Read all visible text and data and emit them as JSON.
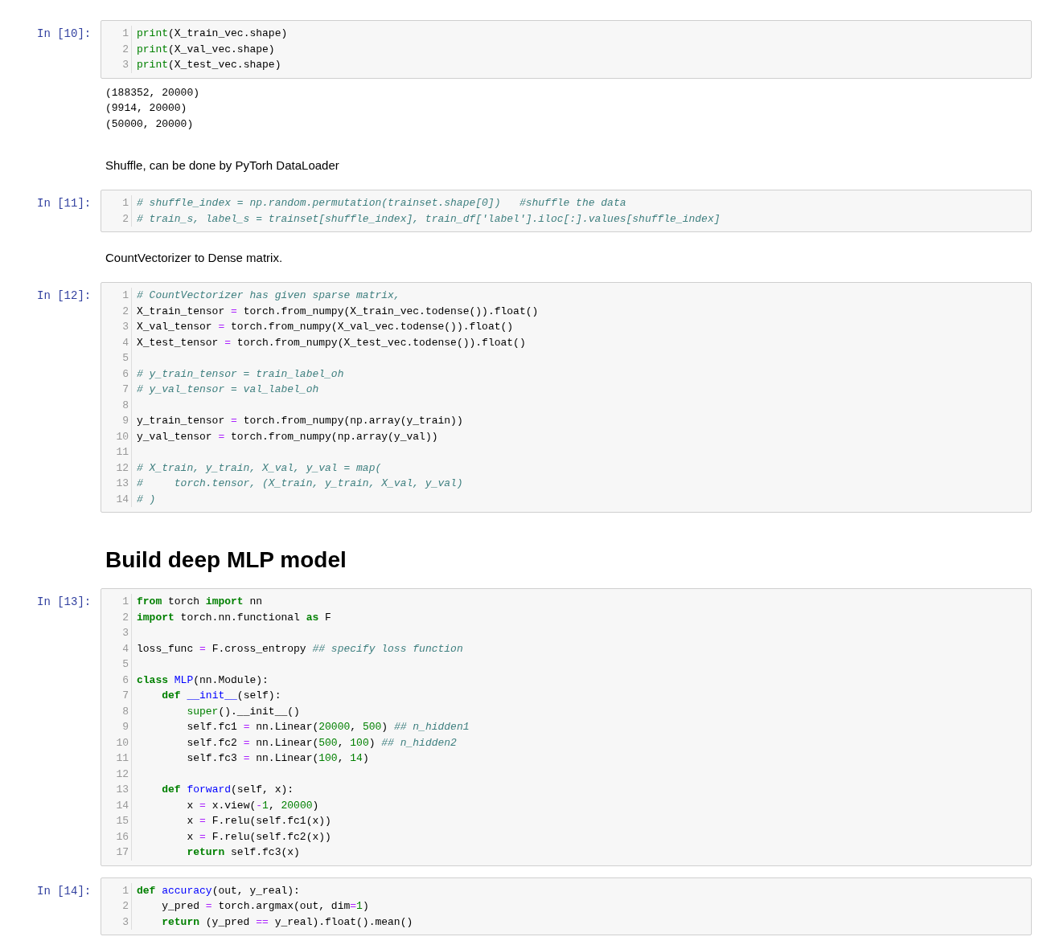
{
  "cells": [
    {
      "kind": "code",
      "prompt": "In [10]:",
      "lines": [
        {
          "n": "1",
          "tokens": [
            {
              "kind": "builtin",
              "text": "print"
            },
            {
              "kind": "plain",
              "text": "(X_train_vec.shape)"
            }
          ]
        },
        {
          "n": "2",
          "tokens": [
            {
              "kind": "builtin",
              "text": "print"
            },
            {
              "kind": "plain",
              "text": "(X_val_vec.shape)"
            }
          ]
        },
        {
          "n": "3",
          "tokens": [
            {
              "kind": "builtin",
              "text": "print"
            },
            {
              "kind": "plain",
              "text": "(X_test_vec.shape)"
            }
          ]
        }
      ]
    },
    {
      "kind": "output",
      "lines": [
        "(188352, 20000)",
        "(9914, 20000)",
        "(50000, 20000)"
      ]
    },
    {
      "kind": "markdown",
      "text": "Shuffle, can be done by PyTorh DataLoader"
    },
    {
      "kind": "code",
      "prompt": "In [11]:",
      "lines": [
        {
          "n": "1",
          "tokens": [
            {
              "kind": "comment",
              "text": "# shuffle_index = np.random.permutation(trainset.shape[0])   #shuffle the data"
            }
          ]
        },
        {
          "n": "2",
          "tokens": [
            {
              "kind": "comment",
              "text": "# train_s, label_s = trainset[shuffle_index], train_df['label'].iloc[:].values[shuffle_index]"
            }
          ]
        }
      ]
    },
    {
      "kind": "markdown",
      "text": "CountVectorizer to Dense matrix."
    },
    {
      "kind": "code",
      "prompt": "In [12]:",
      "lines": [
        {
          "n": "1",
          "tokens": [
            {
              "kind": "comment",
              "text": "# CountVectorizer has given sparse matrix,"
            }
          ]
        },
        {
          "n": "2",
          "tokens": [
            {
              "kind": "plain",
              "text": "X_train_tensor "
            },
            {
              "kind": "operator",
              "text": "="
            },
            {
              "kind": "plain",
              "text": " torch.from_numpy(X_train_vec.todense()).float()"
            }
          ]
        },
        {
          "n": "3",
          "tokens": [
            {
              "kind": "plain",
              "text": "X_val_tensor "
            },
            {
              "kind": "operator",
              "text": "="
            },
            {
              "kind": "plain",
              "text": " torch.from_numpy(X_val_vec.todense()).float()"
            }
          ]
        },
        {
          "n": "4",
          "tokens": [
            {
              "kind": "plain",
              "text": "X_test_tensor "
            },
            {
              "kind": "operator",
              "text": "="
            },
            {
              "kind": "plain",
              "text": " torch.from_numpy(X_test_vec.todense()).float()"
            }
          ]
        },
        {
          "n": "5"
        },
        {
          "n": "6",
          "tokens": [
            {
              "kind": "comment",
              "text": "# y_train_tensor = train_label_oh"
            }
          ]
        },
        {
          "n": "7",
          "tokens": [
            {
              "kind": "comment",
              "text": "# y_val_tensor = val_label_oh"
            }
          ]
        },
        {
          "n": "8"
        },
        {
          "n": "9",
          "tokens": [
            {
              "kind": "plain",
              "text": "y_train_tensor "
            },
            {
              "kind": "operator",
              "text": "="
            },
            {
              "kind": "plain",
              "text": " torch.from_numpy(np.array(y_train))"
            }
          ]
        },
        {
          "n": "10",
          "tokens": [
            {
              "kind": "plain",
              "text": "y_val_tensor "
            },
            {
              "kind": "operator",
              "text": "="
            },
            {
              "kind": "plain",
              "text": " torch.from_numpy(np.array(y_val))"
            }
          ]
        },
        {
          "n": "11"
        },
        {
          "n": "12",
          "tokens": [
            {
              "kind": "comment",
              "text": "# X_train, y_train, X_val, y_val = map("
            }
          ]
        },
        {
          "n": "13",
          "tokens": [
            {
              "kind": "comment",
              "text": "#     torch.tensor, (X_train, y_train, X_val, y_val)"
            }
          ]
        },
        {
          "n": "14",
          "tokens": [
            {
              "kind": "comment",
              "text": "# )"
            }
          ]
        }
      ]
    },
    {
      "kind": "heading",
      "text": "Build deep MLP model"
    },
    {
      "kind": "code",
      "prompt": "In [13]:",
      "lines": [
        {
          "n": "1",
          "tokens": [
            {
              "kind": "keyword",
              "text": "from"
            },
            {
              "kind": "plain",
              "text": " torch "
            },
            {
              "kind": "keyword",
              "text": "import"
            },
            {
              "kind": "plain",
              "text": " nn"
            }
          ]
        },
        {
          "n": "2",
          "tokens": [
            {
              "kind": "keyword",
              "text": "import"
            },
            {
              "kind": "plain",
              "text": " torch.nn.functional "
            },
            {
              "kind": "keyword",
              "text": "as"
            },
            {
              "kind": "plain",
              "text": " F"
            }
          ]
        },
        {
          "n": "3"
        },
        {
          "n": "4",
          "tokens": [
            {
              "kind": "plain",
              "text": "loss_func "
            },
            {
              "kind": "operator",
              "text": "="
            },
            {
              "kind": "plain",
              "text": " F.cross_entropy "
            },
            {
              "kind": "comment",
              "text": "## specify loss function"
            }
          ]
        },
        {
          "n": "5"
        },
        {
          "n": "6",
          "tokens": [
            {
              "kind": "keyword",
              "text": "class "
            },
            {
              "kind": "name",
              "text": "MLP"
            },
            {
              "kind": "plain",
              "text": "(nn.Module):"
            }
          ]
        },
        {
          "n": "7",
          "tokens": [
            {
              "kind": "keyword",
              "text": "    def "
            },
            {
              "kind": "name",
              "text": "__init__"
            },
            {
              "kind": "plain",
              "text": "(self):"
            }
          ]
        },
        {
          "n": "8",
          "tokens": [
            {
              "kind": "builtin",
              "text": "        super"
            },
            {
              "kind": "plain",
              "text": "().__init__()"
            }
          ]
        },
        {
          "n": "9",
          "tokens": [
            {
              "kind": "plain",
              "text": "        self.fc1 "
            },
            {
              "kind": "operator",
              "text": "="
            },
            {
              "kind": "plain",
              "text": " nn.Linear("
            },
            {
              "kind": "number",
              "text": "20000"
            },
            {
              "kind": "plain",
              "text": ", "
            },
            {
              "kind": "number",
              "text": "500"
            },
            {
              "kind": "plain",
              "text": ") "
            },
            {
              "kind": "comment",
              "text": "## n_hidden1"
            }
          ]
        },
        {
          "n": "10",
          "tokens": [
            {
              "kind": "plain",
              "text": "        self.fc2 "
            },
            {
              "kind": "operator",
              "text": "="
            },
            {
              "kind": "plain",
              "text": " nn.Linear("
            },
            {
              "kind": "number",
              "text": "500"
            },
            {
              "kind": "plain",
              "text": ", "
            },
            {
              "kind": "number",
              "text": "100"
            },
            {
              "kind": "plain",
              "text": ") "
            },
            {
              "kind": "comment",
              "text": "## n_hidden2"
            }
          ]
        },
        {
          "n": "11",
          "tokens": [
            {
              "kind": "plain",
              "text": "        self.fc3 "
            },
            {
              "kind": "operator",
              "text": "="
            },
            {
              "kind": "plain",
              "text": " nn.Linear("
            },
            {
              "kind": "number",
              "text": "100"
            },
            {
              "kind": "plain",
              "text": ", "
            },
            {
              "kind": "number",
              "text": "14"
            },
            {
              "kind": "plain",
              "text": ")"
            }
          ]
        },
        {
          "n": "12"
        },
        {
          "n": "13",
          "tokens": [
            {
              "kind": "keyword",
              "text": "    def "
            },
            {
              "kind": "name",
              "text": "forward"
            },
            {
              "kind": "plain",
              "text": "(self, x):"
            }
          ]
        },
        {
          "n": "14",
          "tokens": [
            {
              "kind": "plain",
              "text": "        x "
            },
            {
              "kind": "operator",
              "text": "="
            },
            {
              "kind": "plain",
              "text": " x.view("
            },
            {
              "kind": "operator",
              "text": "-"
            },
            {
              "kind": "number",
              "text": "1"
            },
            {
              "kind": "plain",
              "text": ", "
            },
            {
              "kind": "number",
              "text": "20000"
            },
            {
              "kind": "plain",
              "text": ")"
            }
          ]
        },
        {
          "n": "15",
          "tokens": [
            {
              "kind": "plain",
              "text": "        x "
            },
            {
              "kind": "operator",
              "text": "="
            },
            {
              "kind": "plain",
              "text": " F.relu(self.fc1(x))"
            }
          ]
        },
        {
          "n": "16",
          "tokens": [
            {
              "kind": "plain",
              "text": "        x "
            },
            {
              "kind": "operator",
              "text": "="
            },
            {
              "kind": "plain",
              "text": " F.relu(self.fc2(x))"
            }
          ]
        },
        {
          "n": "17",
          "tokens": [
            {
              "kind": "keyword",
              "text": "        return"
            },
            {
              "kind": "plain",
              "text": " self.fc3(x)"
            }
          ]
        }
      ]
    },
    {
      "kind": "code",
      "prompt": "In [14]:",
      "lines": [
        {
          "n": "1",
          "tokens": [
            {
              "kind": "keyword",
              "text": "def "
            },
            {
              "kind": "name",
              "text": "accuracy"
            },
            {
              "kind": "plain",
              "text": "(out, y_real):"
            }
          ]
        },
        {
          "n": "2",
          "tokens": [
            {
              "kind": "plain",
              "text": "    y_pred "
            },
            {
              "kind": "operator",
              "text": "="
            },
            {
              "kind": "plain",
              "text": " torch.argmax(out, dim"
            },
            {
              "kind": "operator",
              "text": "="
            },
            {
              "kind": "number",
              "text": "1"
            },
            {
              "kind": "plain",
              "text": ")"
            }
          ]
        },
        {
          "n": "3",
          "tokens": [
            {
              "kind": "keyword",
              "text": "    return"
            },
            {
              "kind": "plain",
              "text": " (y_pred "
            },
            {
              "kind": "operator",
              "text": "=="
            },
            {
              "kind": "plain",
              "text": " y_real).float().mean()"
            }
          ]
        }
      ]
    }
  ]
}
